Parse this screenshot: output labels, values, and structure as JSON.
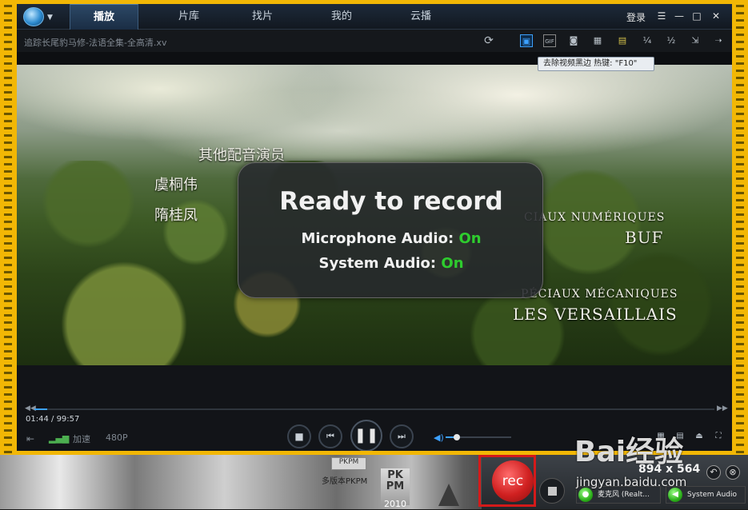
{
  "topbar": {
    "tabs": [
      {
        "label": "播放"
      },
      {
        "label": "片库"
      },
      {
        "label": "找片"
      },
      {
        "label": "我的"
      },
      {
        "label": "云播"
      }
    ],
    "login_label": "登录",
    "window_buttons": {
      "menu": "☰",
      "minimize": "—",
      "maximize": "□",
      "close": "✕"
    }
  },
  "filebar": {
    "filename": "追踪长尾豹马修-法语全集-全高清.xv",
    "tools": {
      "refresh": "⟳",
      "gif": "GIF",
      "half": "½",
      "quarter": "¼"
    }
  },
  "tooltip": {
    "text": "去除视频黑边 热键: \"F10\""
  },
  "video": {
    "credits_left": [
      "其他配音演员",
      "虞桐伟",
      "隋桂凤"
    ],
    "credits_right": [
      "CIAUX NUMÉRIQUES",
      "BUF",
      "PÉCIAUX MÉCANIQUES",
      "LES VERSAILLAIS"
    ]
  },
  "recorder_overlay": {
    "title": "Ready to record",
    "microphone_label": "Microphone Audio:",
    "microphone_state": "On",
    "system_label": "System Audio:",
    "system_state": "On"
  },
  "controls": {
    "current_time": "01:44",
    "total_time": "99:57",
    "speed_label": "加速",
    "quality_label": "480P",
    "progress": 0.019,
    "volume": 0.17
  },
  "desktop": {
    "pkpm_label": "多版本PKPM",
    "pkpm_icon_text": "PKPM",
    "pkpm2010_text": "PK\nPM",
    "pkpm2010_year": "2010"
  },
  "recorder_bar": {
    "rec_label": "rec",
    "size_text": "894 x 564",
    "mic_device": "麦克风 (Realt...",
    "system_audio_label": "System Audio"
  },
  "watermark": {
    "text": "Bai经验",
    "url": "jingyan.baidu.com"
  },
  "colors": {
    "accent_blue": "#3da1ff",
    "rec_red": "#d02020",
    "on_green": "#2ecc2e",
    "frame_yellow": "#f2b705"
  }
}
